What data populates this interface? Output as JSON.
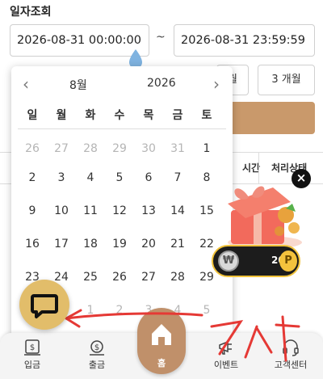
{
  "section": {
    "title": "일자조회"
  },
  "date_range": {
    "start_value": "2026-08-31 00:00:00",
    "separator": "~",
    "end_value": "2026-08-31 23:59:59"
  },
  "period_buttons": {
    "one_month": "월",
    "three_months": "3 개월"
  },
  "table": {
    "headers": {
      "time": "시간",
      "status": "처리상태"
    }
  },
  "calendar": {
    "month": "8월",
    "year": "2026",
    "weekdays": [
      "일",
      "월",
      "화",
      "수",
      "목",
      "금",
      "토"
    ],
    "weeks": [
      [
        {
          "d": "26",
          "o": true
        },
        {
          "d": "27",
          "o": true
        },
        {
          "d": "28",
          "o": true
        },
        {
          "d": "29",
          "o": true
        },
        {
          "d": "30",
          "o": true
        },
        {
          "d": "31",
          "o": true
        },
        {
          "d": "1",
          "o": false
        }
      ],
      [
        {
          "d": "2",
          "o": false
        },
        {
          "d": "3",
          "o": false
        },
        {
          "d": "4",
          "o": false
        },
        {
          "d": "5",
          "o": false
        },
        {
          "d": "6",
          "o": false
        },
        {
          "d": "7",
          "o": false
        },
        {
          "d": "8",
          "o": false
        }
      ],
      [
        {
          "d": "9",
          "o": false
        },
        {
          "d": "10",
          "o": false
        },
        {
          "d": "11",
          "o": false
        },
        {
          "d": "12",
          "o": false
        },
        {
          "d": "13",
          "o": false
        },
        {
          "d": "14",
          "o": false
        },
        {
          "d": "15",
          "o": false
        }
      ],
      [
        {
          "d": "16",
          "o": false
        },
        {
          "d": "17",
          "o": false
        },
        {
          "d": "18",
          "o": false
        },
        {
          "d": "19",
          "o": false
        },
        {
          "d": "20",
          "o": false
        },
        {
          "d": "21",
          "o": false
        },
        {
          "d": "22",
          "o": false
        }
      ],
      [
        {
          "d": "23",
          "o": false
        },
        {
          "d": "24",
          "o": false
        },
        {
          "d": "25",
          "o": false
        },
        {
          "d": "26",
          "o": false
        },
        {
          "d": "27",
          "o": false
        },
        {
          "d": "28",
          "o": false
        },
        {
          "d": "29",
          "o": false
        }
      ],
      [
        {
          "d": "30",
          "o": false
        },
        {
          "d": "31",
          "o": false
        },
        {
          "d": "1",
          "o": true
        },
        {
          "d": "2",
          "o": true
        },
        {
          "d": "3",
          "o": true
        },
        {
          "d": "4",
          "o": true
        },
        {
          "d": "5",
          "o": true
        }
      ]
    ]
  },
  "promo": {
    "close_label": "×",
    "points_value": "20",
    "points_unit": "P",
    "coin_symbol": "₩"
  },
  "nav": {
    "deposit": "입금",
    "withdraw": "출금",
    "home": "홈",
    "event": "이벤트",
    "support": "고객센터"
  },
  "annotation": {
    "handwriting": "7시"
  },
  "colors": {
    "accent": "#c9996b",
    "chat": "#e2bd6a",
    "annotation": "#e53935",
    "point_border": "#f0c23a"
  }
}
